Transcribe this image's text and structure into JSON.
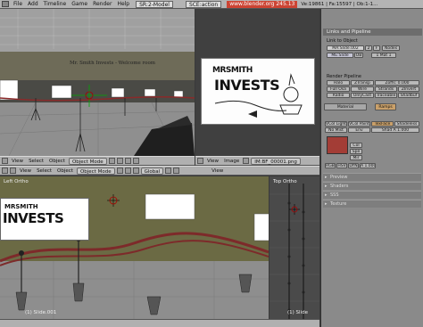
{
  "topbar": {
    "menus": [
      "File",
      "Add",
      "Timeline",
      "Game",
      "Render",
      "Help"
    ],
    "scene_field": "SR:2-Model",
    "action_field": "SCE:action",
    "url": "www.blender.org 245.13",
    "stats": "Ve:19861 | Fa:15597 | Ob:1-1..."
  },
  "persp_view": {
    "header": {
      "view": "View",
      "select": "Select",
      "object": "Object",
      "mode": "Object Mode"
    },
    "wall_text": "Mr. Smith Invests - Welcome room"
  },
  "image_view": {
    "header": {
      "view": "View",
      "image": "Image",
      "filename": "IM:BF_00001.png"
    },
    "logo_line1": "MRSMITH",
    "logo_line2": "INVESTS"
  },
  "left_view": {
    "label": "Left Ortho",
    "footer": "(1) Slide.001",
    "logo_line1": "MRSMITH",
    "logo_line2": "INVESTS"
  },
  "top_view": {
    "label": "Top Ortho",
    "footer": "(1) Slide"
  },
  "bottom_header": {
    "view": "View",
    "select": "Select",
    "object": "Object",
    "mode": "Object Mode",
    "orientation": "Global",
    "view2": "View"
  },
  "buttons": {
    "links_header": "Links and Pipeline",
    "link_to_object": "Link to Object",
    "ma_field": "MA:Slide.002",
    "me_field": "ME:Slide",
    "ob_label": "OB",
    "users": "2",
    "f_label": "F",
    "nodes": "Nodes",
    "mat_count": "1 Mat 1",
    "render_pipeline": "Render Pipeline",
    "row1": [
      "Halo",
      "ZTransp",
      "Zoffs: 0.000"
    ],
    "row2": [
      "Full Osa",
      "Wire",
      "Strands",
      "ZInvert"
    ],
    "row3": [
      "Radio",
      "OnlyCast",
      "Traceable",
      "Shadbuf"
    ],
    "tabs": [
      "Material",
      "Ramps"
    ],
    "shade_row1": [
      "VCol Light",
      "VCol Paint",
      "TexFace",
      "Shadeless"
    ],
    "shade_row2": [
      "No Mist",
      "Env",
      "Shad A 1.000"
    ],
    "color_btns": [
      "Col",
      "Spe",
      "Mir"
    ],
    "color_modes": [
      "RGB",
      "HSV",
      "DYN"
    ],
    "alpha": "A 1.000",
    "collapsed": [
      "Preview",
      "Shaders",
      "SSS",
      "Texture"
    ]
  },
  "colors": {
    "accent_red": "#c43333",
    "blender_grey": "#8a8a8a",
    "material_red": "#a33d36"
  }
}
